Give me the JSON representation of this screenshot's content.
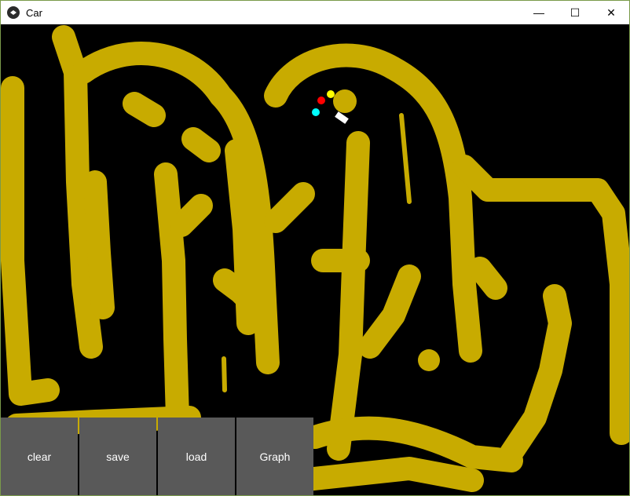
{
  "window": {
    "title": "Car",
    "icon": "kivy-icon",
    "controls": {
      "minimize": "—",
      "maximize": "☐",
      "close": "✕"
    }
  },
  "colors": {
    "sand": "#c8ab00",
    "background": "#000000",
    "button_bg": "#595959",
    "sensor_red": "#ff0000",
    "sensor_yellow": "#ffff00",
    "sensor_cyan": "#00ffff",
    "car": "#ffffff"
  },
  "buttons": {
    "clear": "clear",
    "save": "save",
    "load": "load",
    "graph": "Graph"
  }
}
